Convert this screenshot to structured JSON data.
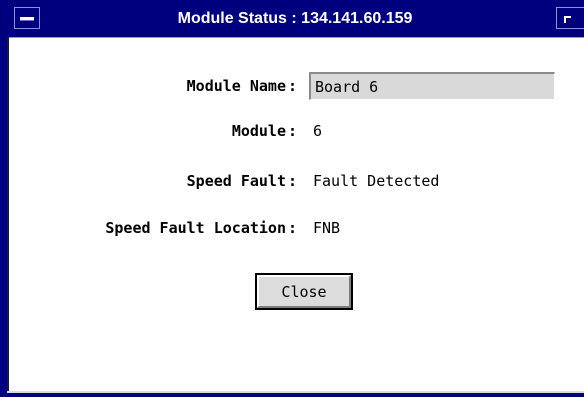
{
  "window": {
    "title": "Module Status : 134.141.60.159"
  },
  "fields": {
    "module_name": {
      "label": "Module Name",
      "value": "Board 6"
    },
    "module": {
      "label": "Module",
      "value": "6"
    },
    "speed_fault": {
      "label": "Speed Fault",
      "value": "Fault Detected"
    },
    "speed_fault_location": {
      "label": "Speed Fault Location",
      "value": "FNB"
    },
    "separator": ":"
  },
  "buttons": {
    "close_label": "Close"
  },
  "colors": {
    "titlebar": "#00007e",
    "input_background": "#d9d9d9",
    "button_face": "#dcdcdc"
  }
}
